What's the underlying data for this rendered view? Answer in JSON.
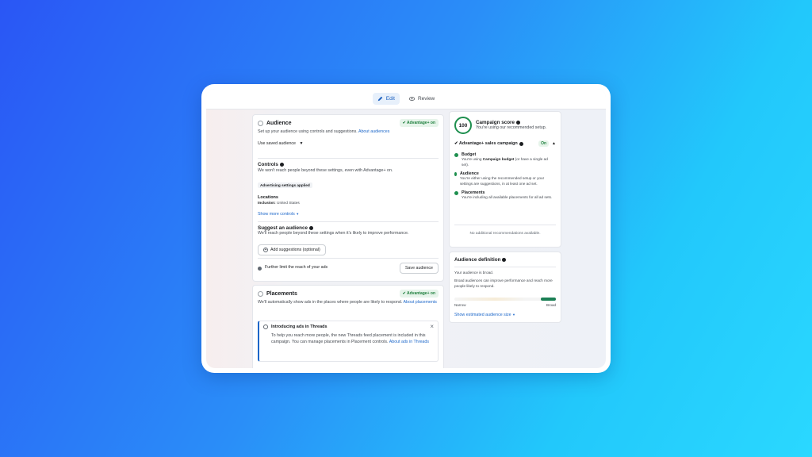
{
  "tabs": [
    {
      "label": "Edit",
      "active": true
    },
    {
      "label": "Review",
      "active": false
    }
  ],
  "audience": {
    "title": "Audience",
    "badge": "✔ Advantage+ on",
    "description": "Set up your audience using controls and suggestions.",
    "link": "About audiences",
    "saved_select": "Use saved audience",
    "controls_title": "Controls",
    "controls_desc": "We won't reach people beyond these settings, even with Advantage+ on.",
    "settings_tag": "Advertising settings applied",
    "locations_label": "Locations",
    "inclusion_label": "Inclusion:",
    "inclusion_value": "United States",
    "show_more": "Show more controls",
    "suggest_title": "Suggest an audience",
    "suggest_desc": "We'll reach people beyond these settings when it's likely to improve performance.",
    "add_suggestions": "Add suggestions (optional)",
    "further_limit": "Further limit the reach of your ads",
    "save_audience": "Save audience"
  },
  "placements": {
    "title": "Placements",
    "badge": "✔ Advantage+ on",
    "description": "We'll automatically show ads in the places where people are likely to respond.",
    "link": "About placements",
    "notice_title": "Introducing ads in Threads",
    "notice_text": "To help you reach more people, the new Threads feed placement is included in this campaign. You can manage placements in Placement controls.",
    "notice_link": "About ads in Threads"
  },
  "score": {
    "value": "100",
    "title": "Campaign score",
    "subtitle": "You're using our recommended setup.",
    "campaign_label": "✔ Advantage+ sales campaign",
    "on_label": "On",
    "items": [
      {
        "title": "Budget",
        "desc_pre": "You're using ",
        "desc_bold": "Campaign budget",
        "desc_post": " (or have a single ad set)."
      },
      {
        "title": "Audience",
        "desc_pre": "You're either using the recommended setup or your settings are suggestions, in at least one ad set.",
        "desc_bold": "",
        "desc_post": ""
      },
      {
        "title": "Placements",
        "desc_pre": "You're including all available placements for all ad sets.",
        "desc_bold": "",
        "desc_post": ""
      }
    ],
    "no_recs": "No additional recommendations available."
  },
  "definition": {
    "title": "Audience definition",
    "status": "Your audience is broad.",
    "desc": "Broad audiences can improve performance and reach more people likely to respond.",
    "narrow": "Narrow",
    "broad": "Broad",
    "level": 0.85,
    "show_size": "Show estimated audience size"
  },
  "colors": {
    "accent": "#1b66c9",
    "success": "#1e8f4e"
  }
}
